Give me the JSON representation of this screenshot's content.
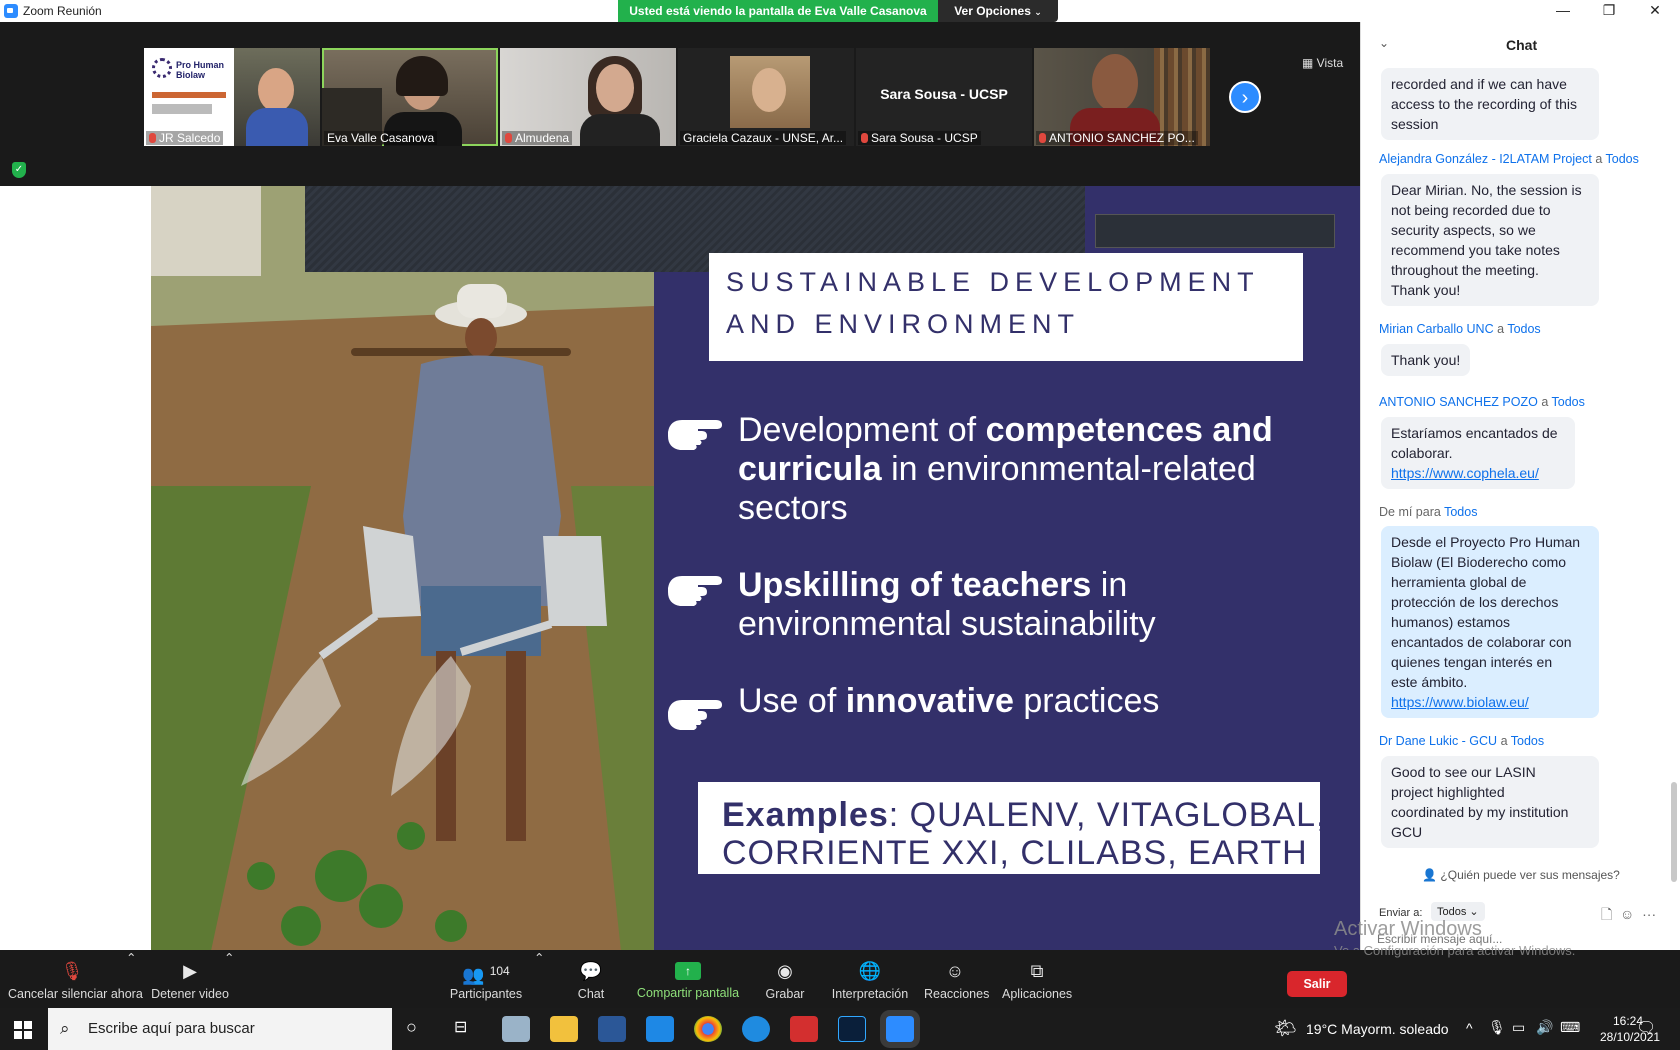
{
  "window": {
    "title": "Zoom Reunión",
    "share_banner": "Usted está viendo la pantalla de Eva Valle Casanova",
    "view_options": "Ver Opciones",
    "minimize": "—",
    "restore": "❐",
    "close": "✕"
  },
  "gallery": {
    "view_label": "Vista",
    "participants": [
      {
        "name": "JR Salcedo",
        "muted": true,
        "logo_text": "Pro Human Biolaw"
      },
      {
        "name": "Eva Valle Casanova",
        "muted": false
      },
      {
        "name": "Almudena",
        "muted": true
      },
      {
        "name": "Graciela Cazaux - UNSE, Ar...",
        "muted": false
      },
      {
        "name": "Sara Sousa - UCSP",
        "muted": true,
        "video_off_label": "Sara Sousa - UCSP"
      },
      {
        "name": "ANTONIO SANCHEZ PO...",
        "muted": true
      }
    ],
    "next_icon": "chevron-right-icon"
  },
  "slide": {
    "heading_line1": "SUSTAINABLE DEVELOPMENT",
    "heading_line2": "AND ENVIRONMENT",
    "bullet1_pre": "Development of ",
    "bullet1_bold": "competences and",
    "bullet1_line2_bold": "curricula",
    "bullet1_line2_rest": " in environmental-related",
    "bullet1_line3": "sectors",
    "bullet2_bold": "Upskilling of teachers",
    "bullet2_rest": " in",
    "bullet2_line2": "environmental sustainability",
    "bullet3_pre": "Use of ",
    "bullet3_bold": "innovative",
    "bullet3_rest": " practices",
    "examples_bold": "Examples",
    "examples_rest": ": QUALENV, VITAGLOBAL,",
    "examples_line2": "CORRIENTE XXI, CLILABS, EARTH",
    "hand_icon": "pointing-hand-icon"
  },
  "chat": {
    "title": "Chat",
    "messages": [
      {
        "text_lines": [
          "recorded and if we can have",
          "access to the recording of this",
          "session"
        ]
      },
      {
        "sender": "Alejandra González - I2LATAM Project",
        "to_word": "a",
        "to": "Todos",
        "text_lines": [
          "Dear Mirian. No, the session is",
          "not being recorded due to",
          "security aspects, so we",
          "recommend you take notes",
          "throughout the meeting.",
          "Thank you!"
        ]
      },
      {
        "sender": "Mirian Carballo UNC",
        "to_word": "a",
        "to": "Todos",
        "text_lines": [
          "Thank you!"
        ]
      },
      {
        "sender": "ANTONIO SANCHEZ POZO",
        "to_word": "a",
        "to": "Todos",
        "text_lines": [
          "Estaríamos encantados de",
          "colaborar."
        ],
        "link": "https://www.cophela.eu/"
      },
      {
        "sender": "De mí para",
        "to": "Todos",
        "text_lines": [
          "Desde el Proyecto Pro Human",
          "Biolaw (El Bioderecho como",
          "herramienta global de",
          "protección de los derechos",
          "humanos) estamos",
          "encantados de colaborar con",
          "quienes tengan interés en",
          "este ámbito."
        ],
        "link": "https://www.biolaw.eu/"
      },
      {
        "sender": "Dr Dane Lukic - GCU",
        "to_word": "a",
        "to": "Todos",
        "text_lines": [
          "Good to see our LASIN",
          "project highlighted",
          "coordinated by my institution",
          "GCU"
        ]
      }
    ],
    "who_can_see": "¿Quién puede ver sus mensajes?",
    "send_to_label": "Enviar a:",
    "send_to_value": "Todos",
    "input_placeholder": "Escribir mensaje aquí..."
  },
  "activation_watermark": {
    "line1": "Activar Windows",
    "line2": "Ve a Configuración para activar Windows."
  },
  "toolbar": {
    "mute": "Cancelar silenciar ahora",
    "video": "Detener video",
    "participants": "Participantes",
    "participants_count": "104",
    "chat": "Chat",
    "share": "Compartir pantalla",
    "record": "Grabar",
    "interpretation": "Interpretación",
    "reactions": "Reacciones",
    "apps": "Aplicaciones",
    "leave": "Salir"
  },
  "taskbar": {
    "search_placeholder": "Escribe aquí para buscar",
    "weather": "19°C  Mayorm. soleado",
    "time": "16:24",
    "date": "28/10/2021"
  },
  "colors": {
    "slide_bg": "#33306a",
    "share_green": "#22b14c",
    "zoom_blue": "#2d8cff",
    "leave_red": "#d9262c"
  }
}
